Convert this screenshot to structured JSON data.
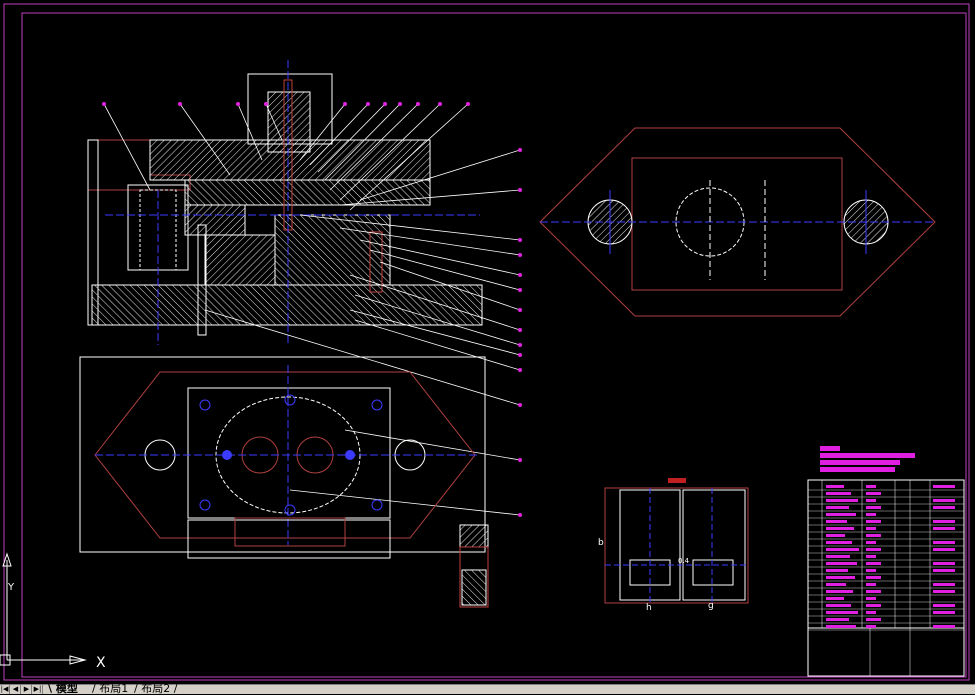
{
  "axis": {
    "x_label": "X",
    "y_label": "Y"
  },
  "tabs": [
    {
      "label": "模型",
      "active": true
    },
    {
      "label": "布局1",
      "active": false
    },
    {
      "label": "布局2",
      "active": false
    }
  ],
  "drawing": {
    "dimension_h": "h",
    "dimension_b": "b",
    "dimension_g": "g",
    "tolerance": "0.4"
  },
  "colors": {
    "background": "#000000",
    "frame": "#c040c0",
    "hatch": "#ffffff",
    "center_line": "#3b3bff",
    "outline": "#b04040",
    "title_fill": "#e020e0",
    "leader": "#ffffff"
  }
}
